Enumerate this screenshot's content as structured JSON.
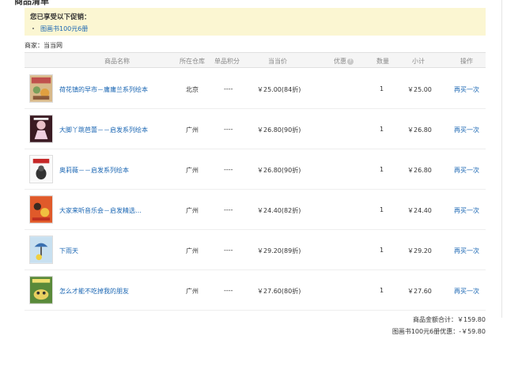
{
  "page": {
    "title": "商品清单"
  },
  "promo": {
    "title": "您已享受以下促销：",
    "items": [
      "图画书100元6册"
    ]
  },
  "shop": {
    "label": "商家：当当网"
  },
  "table": {
    "headers": {
      "name": "商品名称",
      "warehouse": "所在仓库",
      "points": "单品积分",
      "price": "当当价",
      "discount": "优惠",
      "qty": "数量",
      "subtotal": "小计",
      "action": "操作"
    },
    "rows": [
      {
        "name": "荷花镇的早市－庸庸兰系列绘本",
        "warehouse": "北京",
        "points": "----",
        "price": "￥25.00(84折)",
        "qty": "1",
        "subtotal": "￥25.00",
        "action": "再买一次",
        "cover": "cover-hehua"
      },
      {
        "name": "大脚丫跳芭蕾－－启发系列绘本",
        "warehouse": "广州",
        "points": "----",
        "price": "￥26.80(90折)",
        "qty": "1",
        "subtotal": "￥26.80",
        "action": "再买一次",
        "cover": "cover-dajiaoya"
      },
      {
        "name": "奥莉薇－－启发系列绘本",
        "warehouse": "广州",
        "points": "----",
        "price": "￥26.80(90折)",
        "qty": "1",
        "subtotal": "￥26.80",
        "action": "再买一次",
        "cover": "cover-aoliwei"
      },
      {
        "name": "大家来听音乐会－启发精选…",
        "warehouse": "广州",
        "points": "----",
        "price": "￥24.40(82折)",
        "qty": "1",
        "subtotal": "￥24.40",
        "action": "再买一次",
        "cover": "cover-yinyuehui"
      },
      {
        "name": "下雨天",
        "warehouse": "广州",
        "points": "----",
        "price": "￥29.20(89折)",
        "qty": "1",
        "subtotal": "￥29.20",
        "action": "再买一次",
        "cover": "cover-xiayutian"
      },
      {
        "name": "怎么才能不吃掉我的朋友",
        "warehouse": "广州",
        "points": "----",
        "price": "￥27.60(80折)",
        "qty": "1",
        "subtotal": "￥27.60",
        "action": "再买一次",
        "cover": "cover-pengyou"
      }
    ]
  },
  "summary": {
    "total": "商品金额合计：￥159.80",
    "discount": "图画书100元6册优惠：-￥59.80"
  },
  "colors": {
    "link": "#1a66b3",
    "promo_bg": "#fbf6d2",
    "header_bg": "#f5f5f5"
  }
}
